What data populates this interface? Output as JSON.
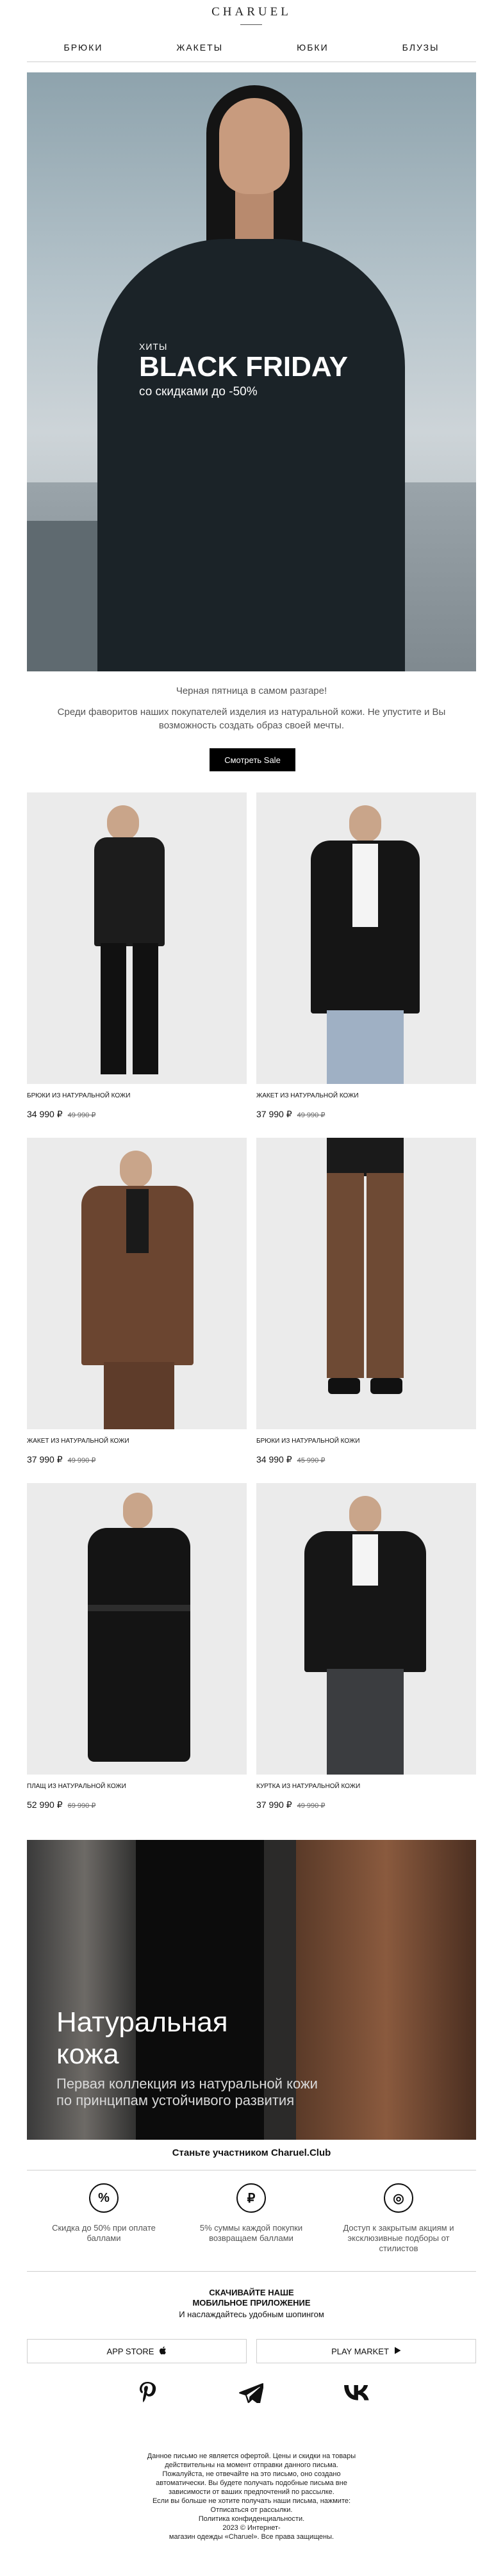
{
  "header": {
    "logo": "CHARUEL",
    "nav": [
      "БРЮКИ",
      "ЖАКЕТЫ",
      "ЮБКИ",
      "БЛУЗЫ"
    ]
  },
  "hero": {
    "kicker": "ХИТЫ",
    "title": "BLACK FRIDAY",
    "subtitle": "со скидками до -50%"
  },
  "intro": {
    "line1": "Черная пятница в самом разгаре!",
    "line2": "Среди фаворитов наших покупателей изделия из натуральной кожи. Не упустите и Вы возможность создать образ своей мечты.",
    "cta": "Смотреть Sale"
  },
  "products": [
    {
      "name": "БРЮКИ ИЗ НАТУРАЛЬНОЙ КОЖИ",
      "price": "34 990 ₽",
      "old_price": "49 990 ₽"
    },
    {
      "name": "ЖАКЕТ ИЗ НАТУРАЛЬНОЙ КОЖИ",
      "price": "37 990 ₽",
      "old_price": "49 990 ₽"
    },
    {
      "name": "ЖАКЕТ ИЗ НАТУРАЛЬНОЙ КОЖИ",
      "price": "37 990 ₽",
      "old_price": "49 990 ₽"
    },
    {
      "name": "БРЮКИ ИЗ НАТУРАЛЬНОЙ КОЖИ",
      "price": "34 990 ₽",
      "old_price": "45 990 ₽"
    },
    {
      "name": "ПЛАЩ ИЗ НАТУРАЛЬНОЙ КОЖИ",
      "price": "52 990 ₽",
      "old_price": "69 990 ₽"
    },
    {
      "name": "КУРТКА ИЗ НАТУРАЛЬНОЙ КОЖИ",
      "price": "37 990 ₽",
      "old_price": "49 990 ₽"
    }
  ],
  "banner": {
    "title_line1": "Натуральная",
    "title_line2": "кожа",
    "sub_line1": "Первая коллекция из натуральной кожи",
    "sub_line2": "по принципам устойчивого развития"
  },
  "club": {
    "title": "Станьте участником Charuel.Club",
    "items": [
      {
        "icon": "percent-icon",
        "glyph": "%",
        "text": "Скидка до 50% при оплате баллами"
      },
      {
        "icon": "ruble-icon",
        "glyph": "₽",
        "text": "5% суммы каждой покупки возвращаем баллами"
      },
      {
        "icon": "clothes-icon",
        "glyph": "◎",
        "text": "Доступ к закрытым акциям и эксклюзивные подборы от стилистов"
      }
    ]
  },
  "app": {
    "title_line1": "СКАЧИВАЙТЕ НАШЕ",
    "title_line2": "МОБИЛЬНОЕ ПРИЛОЖЕНИЕ",
    "subtitle": "И наслаждайтесь удобным шопингом",
    "app_store": "APP STORE",
    "play_market": "PLAY MARKET"
  },
  "socials": [
    "pinterest-icon",
    "telegram-icon",
    "vk-icon"
  ],
  "footer": {
    "lines": [
      "Данное письмо не является офертой. Цены и скидки на товары",
      "действительны на момент отправки данного письма.",
      "Пожалуйста, не отвечайте на это письмо, оно создано",
      "автоматически. Вы будете получать подобные письма вне",
      "зависимости от ваших предпочтений по рассылке.",
      "Если вы больше не хотите получать наши письма, нажмите:",
      "Отписаться от рассылки.",
      "Политика конфиденциальности.",
      "2023 © Интернет-",
      "магазин одежды «Charuel». Все права защищены."
    ]
  },
  "colors": {
    "accent": "#000000",
    "text_muted": "#555555",
    "rule": "#cfcfcf"
  }
}
